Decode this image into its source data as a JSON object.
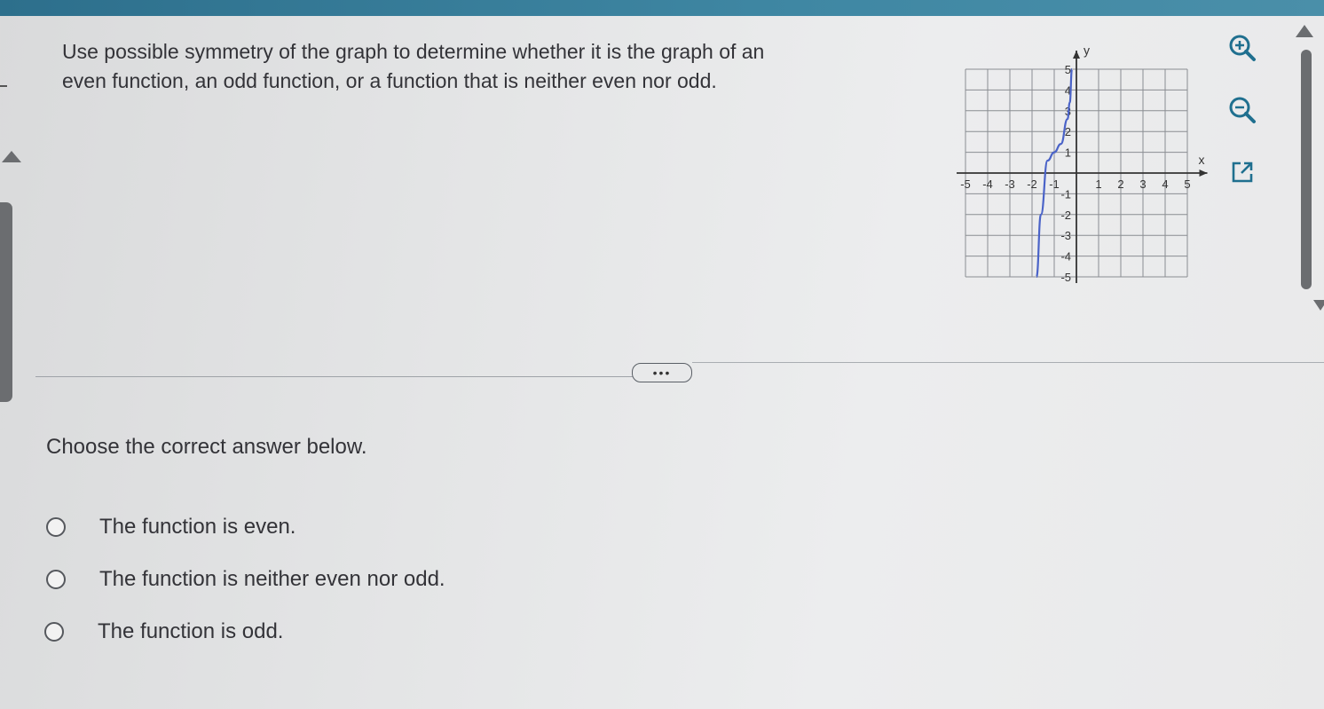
{
  "question": {
    "line1": "Use possible symmetry of the graph to determine whether it is the graph of an",
    "line2": "even function, an odd function, or a function that is neither even nor odd."
  },
  "graph": {
    "x_label": "x",
    "y_label": "y",
    "x_ticks": [
      "-5",
      "-4",
      "-3",
      "-2",
      "-1",
      "1",
      "2",
      "3",
      "4",
      "5"
    ],
    "y_ticks": [
      "5",
      "4",
      "3",
      "2",
      "1",
      "-1",
      "-2",
      "-3",
      "-4",
      "-5"
    ],
    "curve_color": "#4a63c8",
    "curve_points": [
      [
        -1.8,
        -5
      ],
      [
        -1.6,
        -2
      ],
      [
        -1.3,
        0.6
      ],
      [
        -1,
        1
      ],
      [
        -0.7,
        1.4
      ],
      [
        -0.4,
        2.6
      ],
      [
        -0.3,
        3.4
      ],
      [
        -0.2,
        5
      ]
    ]
  },
  "tools": {
    "zoom_in": "zoom-in-icon",
    "zoom_out": "zoom-out-icon",
    "popout": "external-link-icon"
  },
  "more_button": {
    "label": "•••"
  },
  "prompt": "Choose the correct answer below.",
  "options": [
    "The function is even.",
    "The function is neither even nor odd.",
    "The function is odd."
  ],
  "colors": {
    "accent": "#2d6f8c",
    "tool_icon": "#1f6f8f"
  }
}
